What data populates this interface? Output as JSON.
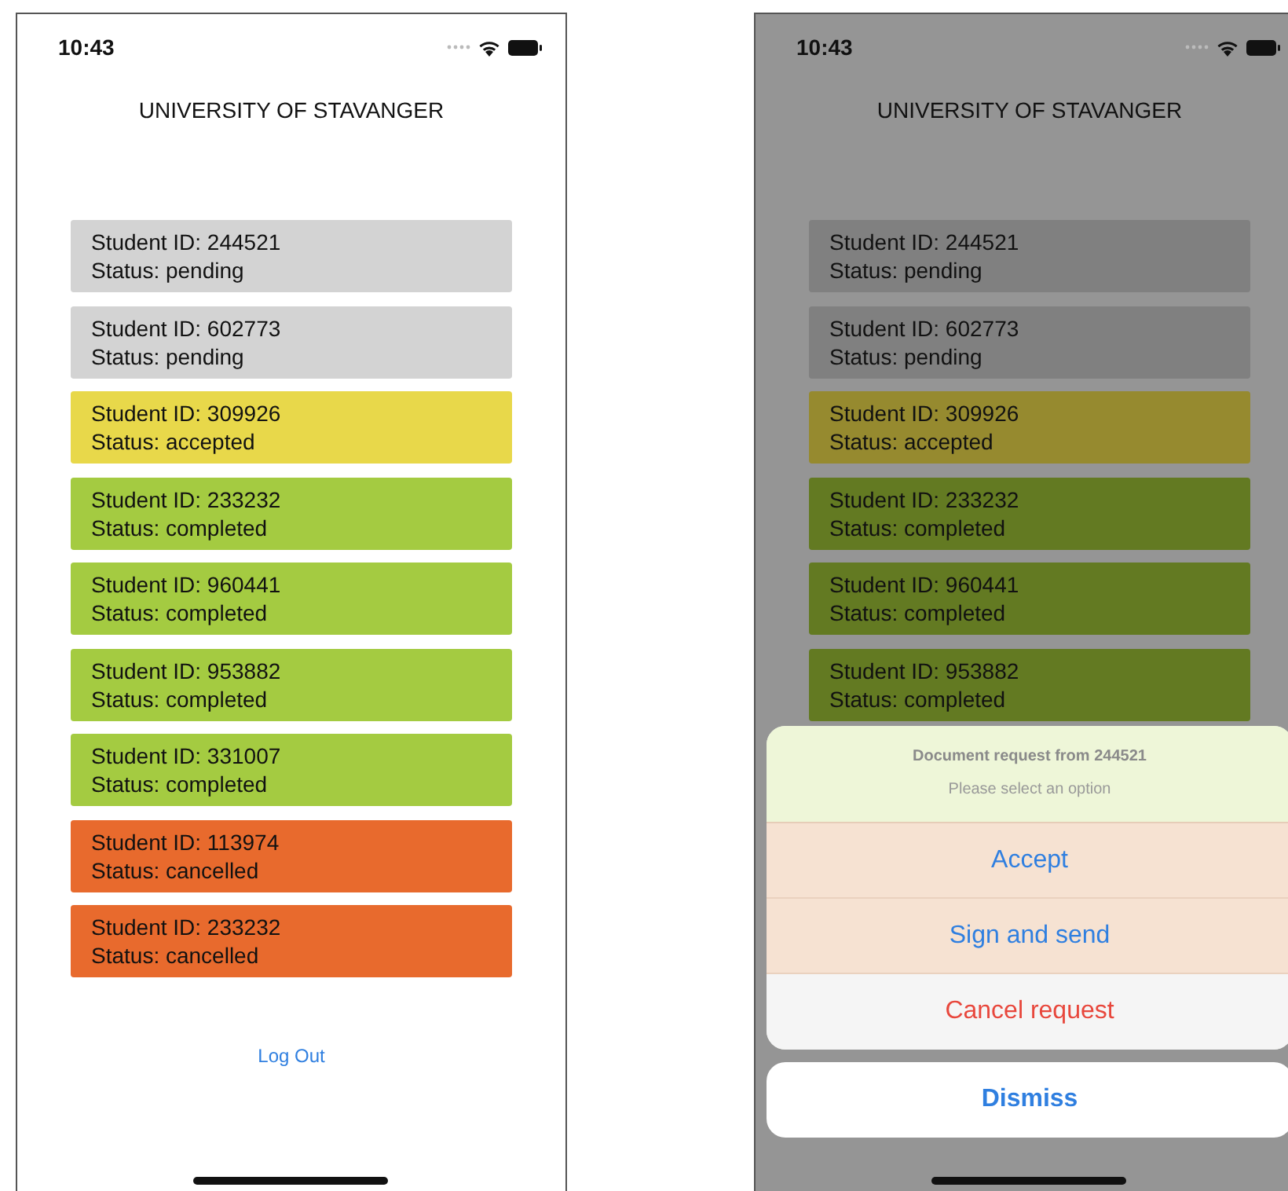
{
  "screens": [
    {
      "time": "10:43",
      "title": "UNIVERSITY OF STAVANGER",
      "dimmed": false,
      "requests": [
        {
          "student": "Student ID: 244521",
          "status": "Status: pending",
          "color": "#d3d3d3"
        },
        {
          "student": "Student ID: 602773",
          "status": "Status: pending",
          "color": "#d3d3d3"
        },
        {
          "student": "Student ID: 309926",
          "status": "Status: accepted",
          "color": "#e8d84a"
        },
        {
          "student": "Student ID: 233232",
          "status": "Status: completed",
          "color": "#a4cb41"
        },
        {
          "student": "Student ID: 960441",
          "status": "Status: completed",
          "color": "#a4cb41"
        },
        {
          "student": "Student ID: 953882",
          "status": "Status: completed",
          "color": "#a4cb41"
        },
        {
          "student": "Student ID: 331007",
          "status": "Status: completed",
          "color": "#a4cb41"
        },
        {
          "student": "Student ID: 113974",
          "status": "Status: cancelled",
          "color": "#e86a2d"
        },
        {
          "student": "Student ID: 233232",
          "status": "Status: cancelled",
          "color": "#e86a2d"
        }
      ],
      "logout": "Log Out"
    },
    {
      "time": "10:43",
      "title": "UNIVERSITY OF STAVANGER",
      "dimmed": true,
      "requests": [
        {
          "student": "Student ID: 244521",
          "status": "Status: pending",
          "color": "#808080"
        },
        {
          "student": "Student ID: 602773",
          "status": "Status: pending",
          "color": "#808080"
        },
        {
          "student": "Student ID: 309926",
          "status": "Status: accepted",
          "color": "#968a2f"
        },
        {
          "student": "Student ID: 233232",
          "status": "Status: completed",
          "color": "#637a22"
        },
        {
          "student": "Student ID: 960441",
          "status": "Status: completed",
          "color": "#637a22"
        },
        {
          "student": "Student ID: 953882",
          "status": "Status: completed",
          "color": "#637a22"
        }
      ],
      "action_sheet": {
        "title": "Document request from 244521",
        "message": "Please select an option",
        "actions": [
          {
            "label": "Accept",
            "kind": "default"
          },
          {
            "label": "Sign and send",
            "kind": "default"
          },
          {
            "label": "Cancel request",
            "kind": "destructive"
          }
        ],
        "cancel": "Dismiss"
      }
    }
  ]
}
